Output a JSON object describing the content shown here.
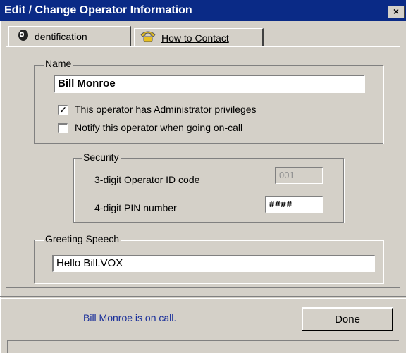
{
  "window": {
    "title": "Edit / Change Operator Information",
    "close_label": "×"
  },
  "tabs": [
    {
      "label": "dentification",
      "icon": "operator-head-icon"
    },
    {
      "label": "How to Contact",
      "icon": "phone-icon"
    }
  ],
  "name_group": {
    "legend": "Name",
    "value": "Bill Monroe",
    "admin_label": "This operator has Administrator privileges",
    "admin_checked": "✓",
    "notify_label": "Notify this operator when going on-call",
    "notify_checked": ""
  },
  "security_group": {
    "legend": "Security",
    "operator_id_label": "3-digit Operator ID code",
    "operator_id_value": "001",
    "pin_label": "4-digit PIN number",
    "pin_value": "####"
  },
  "greeting_group": {
    "legend": "Greeting Speech",
    "value": "Hello Bill.VOX"
  },
  "footer": {
    "status": "Bill Monroe is on call.",
    "done_label": "Done"
  }
}
